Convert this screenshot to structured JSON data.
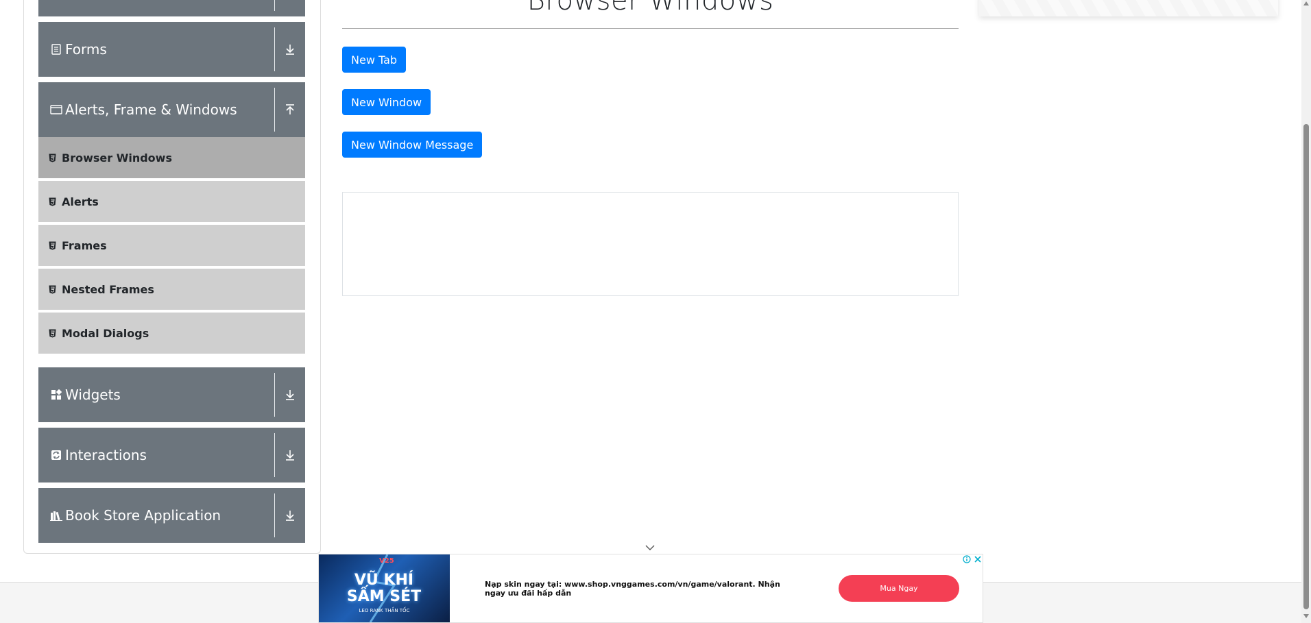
{
  "main": {
    "title": "Browser Windows",
    "buttons": {
      "new_tab": "New Tab",
      "new_window": "New Window",
      "new_window_message": "New Window Message"
    }
  },
  "sidebar": {
    "groups": [
      {
        "label": "Forms",
        "icon": "form-icon",
        "expanded": false
      },
      {
        "label": "Alerts, Frame & Windows",
        "icon": "window-icon",
        "expanded": true
      },
      {
        "label": "Widgets",
        "icon": "widgets-icon",
        "expanded": false
      },
      {
        "label": "Interactions",
        "icon": "interactions-icon",
        "expanded": false
      },
      {
        "label": "Book Store Application",
        "icon": "books-icon",
        "expanded": false
      }
    ],
    "items": [
      {
        "label": "Browser Windows",
        "active": true
      },
      {
        "label": "Alerts",
        "active": false
      },
      {
        "label": "Frames",
        "active": false
      },
      {
        "label": "Nested Frames",
        "active": false
      },
      {
        "label": "Modal Dialogs",
        "active": false
      }
    ]
  },
  "ad": {
    "brand": "V25",
    "headline": "VŨ KHÍ SẤM SÉT",
    "subline": "LEO RANK THẦN TỐC",
    "text": "Nạp skin ngay tại: www.shop.vnggames.com/vn/game/valorant. Nhận ngay ưu đãi hấp dẫn",
    "cta": "Mua Ngay"
  },
  "colors": {
    "primary_button": "#007bff",
    "sidebar_group": "#6c757d",
    "sidebar_item": "#cfcfcf",
    "sidebar_item_active": "#adadad",
    "ad_cta": "#f43f54"
  }
}
